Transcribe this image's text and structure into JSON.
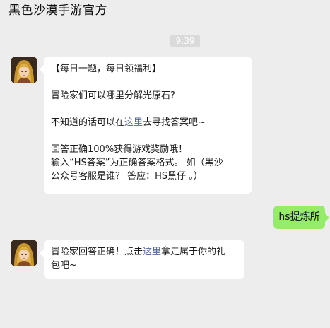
{
  "header": {
    "title": "黑色沙漠手游官方"
  },
  "timestamp": "9:39",
  "message1": {
    "line1": "【每日一题，每日领福利】",
    "line2": "冒险家们可以哪里分解光原石?",
    "line3_pre": "不知道的话可以在",
    "line3_link": "这里",
    "line3_post": "去寻找答案吧~",
    "line4": "回答正确100%获得游戏奖励哦！",
    "line5": "输入“HS答案”为正确答案格式。 如（黑沙",
    "line6": "公众号客服是谁？ 答应：HS黑仔 。）"
  },
  "reply": {
    "text": "hs提炼所"
  },
  "message2": {
    "pre": "冒险家回答正确！点击",
    "link": "这里",
    "post": "拿走属于你的礼",
    "line2": "包吧~"
  },
  "colors": {
    "background": "#ededed",
    "bubble": "#ffffff",
    "sent_bubble": "#95ec69",
    "link": "#576b95"
  }
}
